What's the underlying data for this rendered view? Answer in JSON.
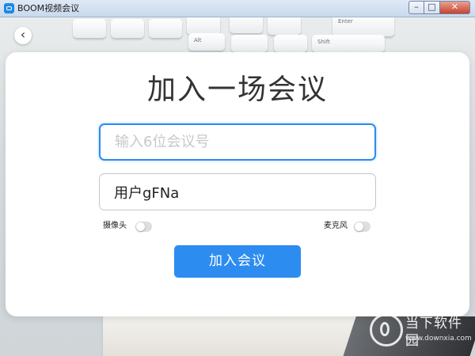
{
  "window": {
    "title": "BOOM视频会议",
    "minimize_glyph": "–",
    "maximize_glyph": "□",
    "close_glyph": "✕"
  },
  "back_button": {
    "icon": "chevron-left-icon",
    "glyph": "‹"
  },
  "background_keys": [
    "Alt",
    "Enter",
    "Shift"
  ],
  "join_meeting": {
    "title": "加入一场会议",
    "meeting_id_input": {
      "value": "",
      "placeholder": "输入6位会议号"
    },
    "username_input": {
      "value": "用户gFNa",
      "placeholder": ""
    },
    "camera": {
      "label": "摄像头",
      "enabled": false
    },
    "microphone": {
      "label": "麦克风",
      "enabled": false
    },
    "join_button_label": "加入会议"
  },
  "watermark": {
    "text": "当下软件园",
    "url": "www.downxia.com"
  },
  "colors": {
    "accent": "#2d8cf0",
    "title_text": "#333333",
    "switch_off": "#dedede"
  }
}
